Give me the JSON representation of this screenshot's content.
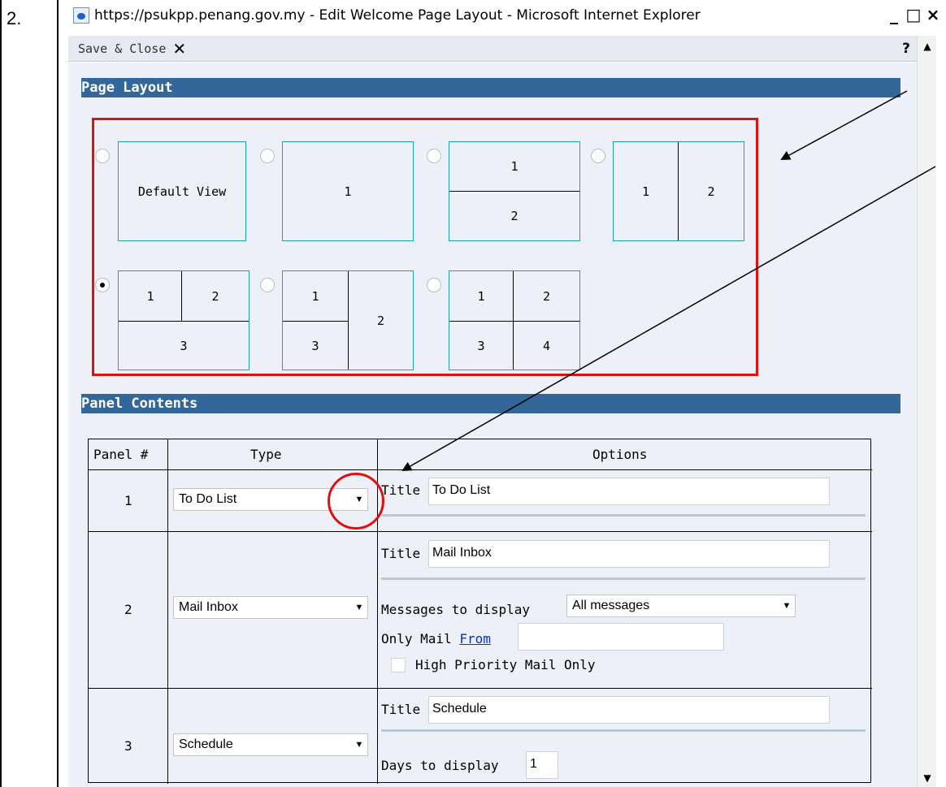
{
  "step_number": "2.",
  "window": {
    "title": "https://psukpp.penang.gov.my - Edit Welcome Page Layout - Microsoft Internet Explorer",
    "controls": [
      "_",
      "□",
      "×"
    ]
  },
  "toolbar": {
    "save_close": "Save & Close",
    "close_glyph": "✕",
    "help": "?"
  },
  "page_layout": {
    "heading": "Page Layout",
    "options": [
      {
        "cells": [
          "Default View"
        ],
        "checked": false
      },
      {
        "cells": [
          "1"
        ],
        "checked": false
      },
      {
        "cells": [
          "1",
          "2"
        ],
        "checked": false
      },
      {
        "cells": [
          "1",
          "2"
        ],
        "checked": false
      },
      {
        "cells": [
          "1",
          "2",
          "3"
        ],
        "checked": true
      },
      {
        "cells": [
          "1",
          "3",
          "2"
        ],
        "checked": false
      },
      {
        "cells": [
          "1",
          "2",
          "3",
          "4"
        ],
        "checked": false
      }
    ]
  },
  "panel_contents": {
    "heading": "Panel Contents",
    "headers": {
      "panel": "Panel #",
      "type": "Type",
      "options": "Options"
    },
    "rows": [
      {
        "num": "1",
        "type": "To Do List",
        "title_label": "Title",
        "title_value": "To Do List"
      },
      {
        "num": "2",
        "type": "Mail Inbox",
        "title_label": "Title",
        "title_value": "Mail Inbox",
        "messages_label": "Messages to display",
        "messages_value": "All messages",
        "only_mail_label": "Only Mail",
        "from_link": "From",
        "from_value": "",
        "high_priority_label": "High Priority Mail Only"
      },
      {
        "num": "3",
        "type": "Schedule",
        "title_label": "Title",
        "title_value": "Schedule",
        "days_label": "Days to display",
        "days_value": "1"
      }
    ]
  },
  "colors": {
    "section_bar": "#336699",
    "annotation_red": "#e01010",
    "layout_border": "#1aa5a5",
    "background": "#eef0f7"
  }
}
